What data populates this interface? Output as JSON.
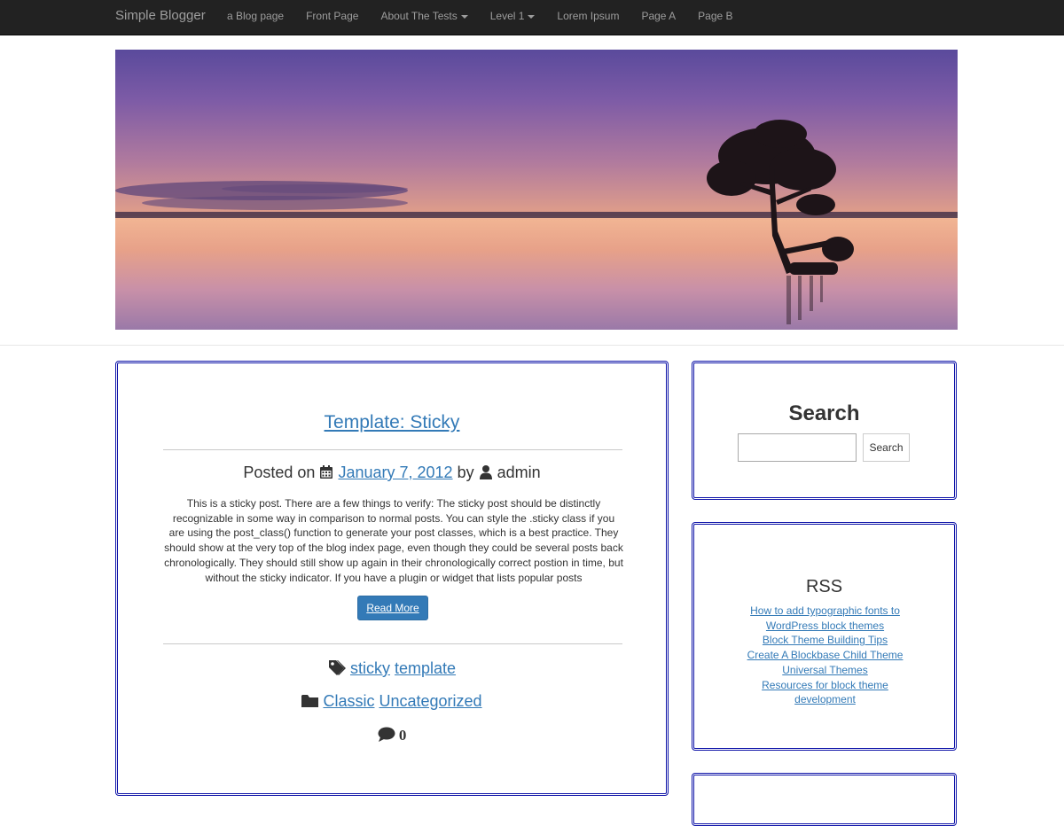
{
  "navbar": {
    "brand": "Simple Blogger",
    "items": [
      {
        "label": "a Blog page",
        "dropdown": false
      },
      {
        "label": "Front Page",
        "dropdown": false
      },
      {
        "label": "About The Tests",
        "dropdown": true
      },
      {
        "label": "Level 1",
        "dropdown": true
      },
      {
        "label": "Lorem Ipsum",
        "dropdown": false
      },
      {
        "label": "Page A",
        "dropdown": false
      },
      {
        "label": "Page B",
        "dropdown": false
      }
    ]
  },
  "post": {
    "title": "Template: Sticky",
    "posted_on": "Posted on",
    "date": "January 7, 2012",
    "by": "by",
    "author": "admin",
    "excerpt": "This is a sticky post. There are a few things to verify: The sticky post should be distinctly recognizable in some way in comparison to normal posts. You can style the .sticky class if you are using the post_class() function to generate your post classes, which is a best practice. They should show at the very top of the blog index page, even though they could be several posts back chronologically. They should still show up again in their chronologically correct postion in time, but without the sticky indicator. If you have a plugin or widget that lists popular posts",
    "read_more": "Read More",
    "tags": [
      "sticky",
      "template"
    ],
    "categories": [
      "Classic",
      "Uncategorized"
    ],
    "comment_count": "0"
  },
  "sidebar": {
    "search": {
      "title": "Search",
      "input_value": "",
      "button_label": "Search"
    },
    "rss": {
      "title": "RSS",
      "links": [
        "How to add typographic fonts to WordPress block themes",
        "Block Theme Building Tips",
        "Create A Blockbase Child Theme",
        "Universal Themes",
        "Resources for block theme development"
      ]
    }
  },
  "colors": {
    "navbar_bg": "#222222",
    "navbar_text": "#9d9d9d",
    "link": "#337ab7",
    "panel_border": "#0f14a8",
    "button_bg": "#337ab7"
  },
  "icons": {
    "date": "calendar-icon",
    "author": "user-icon",
    "tags": "tag-icon",
    "categories": "folder-icon",
    "comments": "comment-icon"
  }
}
